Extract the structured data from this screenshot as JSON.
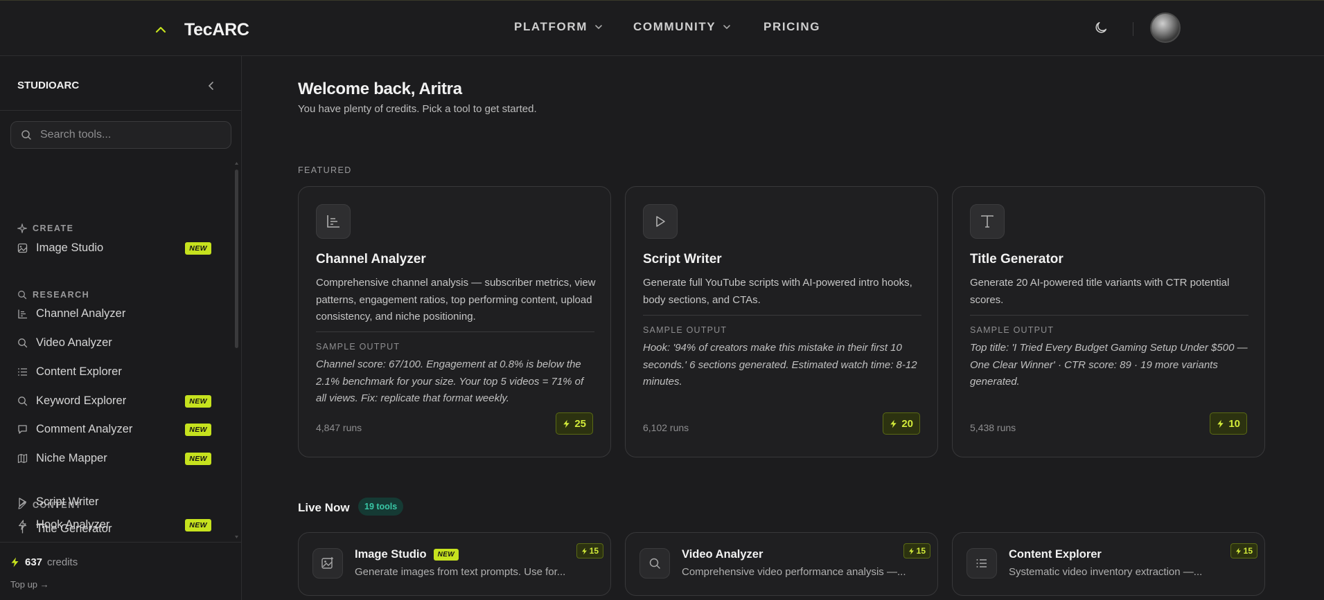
{
  "app": {
    "brand": "TecARC"
  },
  "nav": {
    "items": [
      {
        "label": "PLATFORM"
      },
      {
        "label": "COMMUNITY"
      },
      {
        "label": "PRICING"
      }
    ]
  },
  "sidebar": {
    "title": "STUDIOARC",
    "search_placeholder": "Search tools...",
    "sections": [
      {
        "title": "CREATE",
        "items": [
          {
            "label": "Image Studio",
            "badge": "NEW"
          }
        ]
      },
      {
        "title": "RESEARCH",
        "items": [
          {
            "label": "Channel Analyzer"
          },
          {
            "label": "Video Analyzer"
          },
          {
            "label": "Content Explorer"
          },
          {
            "label": "Keyword Explorer",
            "badge": "NEW"
          },
          {
            "label": "Comment Analyzer",
            "badge": "NEW"
          },
          {
            "label": "Niche Mapper",
            "badge": "NEW"
          }
        ]
      },
      {
        "title": "CONTENT",
        "items": [
          {
            "label": "Hook Analyzer",
            "badge": "NEW"
          },
          {
            "label": "Script Writer"
          },
          {
            "label": "Title Generator"
          }
        ]
      }
    ],
    "credits": {
      "value": "637",
      "unit": "credits",
      "topup": "Top up →"
    }
  },
  "main": {
    "welcome": "Welcome back, Aritra",
    "subtitle": "You have plenty of credits. Pick a tool to get started.",
    "featured_label": "FEATURED",
    "featured": [
      {
        "title": "Channel Analyzer",
        "desc": "Comprehensive channel analysis — subscriber metrics, view patterns, engagement ratios, top performing content, upload consistency, and niche positioning.",
        "sample_label": "SAMPLE OUTPUT",
        "sample": "Channel score: 67/100. Engagement at 0.8% is below the 2.1% benchmark for your size. Your top 5 videos = 71% of all views. Fix: replicate that format weekly.",
        "runs": "4,847 runs",
        "cost": "25"
      },
      {
        "title": "Script Writer",
        "desc": "Generate full YouTube scripts with AI-powered intro hooks, body sections, and CTAs.",
        "sample_label": "SAMPLE OUTPUT",
        "sample": "Hook: '94% of creators make this mistake in their first 10 seconds.' 6 sections generated. Estimated watch time: 8-12 minutes.",
        "runs": "6,102 runs",
        "cost": "20"
      },
      {
        "title": "Title Generator",
        "desc": "Generate 20 AI-powered title variants with CTR potential scores.",
        "sample_label": "SAMPLE OUTPUT",
        "sample": "Top title: 'I Tried Every Budget Gaming Setup Under $500 — One Clear Winner' · CTR score: 89 · 19 more variants generated.",
        "runs": "5,438 runs",
        "cost": "10"
      }
    ],
    "live_label": "Live Now",
    "live_count": "19 tools",
    "live": [
      {
        "title": "Image Studio",
        "badge": "NEW",
        "desc": "Generate images from text prompts. Use for...",
        "cost": "15"
      },
      {
        "title": "Video Analyzer",
        "desc": "Comprehensive video performance analysis —...",
        "cost": "15"
      },
      {
        "title": "Content Explorer",
        "desc": "Systematic video inventory extraction —...",
        "cost": "15"
      }
    ]
  },
  "colors": {
    "accent": "#c6e21e",
    "background": "#1c1c1e",
    "teal": "#39c7a6"
  }
}
